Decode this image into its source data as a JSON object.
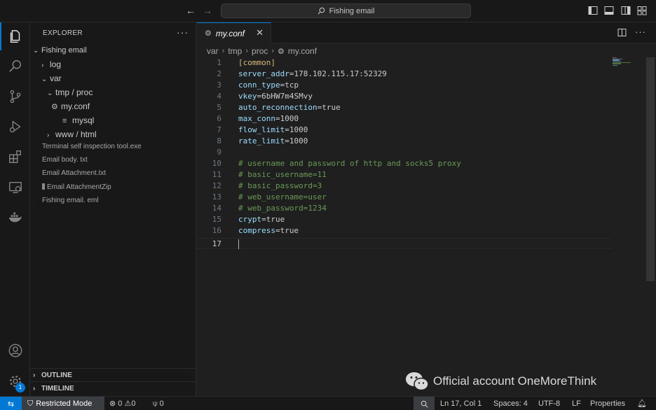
{
  "titlebar": {
    "search_text": "Fishing email"
  },
  "activity": {
    "settings_badge": "1"
  },
  "explorer": {
    "title": "EXPLORER",
    "more": "···",
    "root": "Fishing email",
    "items": {
      "log": "log",
      "var": "var",
      "tmp_proc": "tmp / proc",
      "my_conf": "my.conf",
      "mysql": "mysql",
      "www_html": "www / html",
      "terminal_tool": "Terminal self inspection tool.exe",
      "email_body": "Email body. txt",
      "email_attachment": "Email Attachment.txt",
      "email_attachment_zip": "Email AttachmentZip",
      "fishing_eml": "Fishing email. eml"
    },
    "outline": "OUTLINE",
    "timeline": "TIMELINE"
  },
  "editor": {
    "tab_label": "my.conf",
    "breadcrumb": [
      "var",
      "tmp",
      "proc",
      "my.conf"
    ],
    "lines": [
      {
        "n": "1",
        "text": "[common]"
      },
      {
        "n": "2",
        "key": "server_addr",
        "val": "=178.102.115.17:52329"
      },
      {
        "n": "3",
        "key": "conn_type",
        "val": "=tcp"
      },
      {
        "n": "4",
        "key": "vkey",
        "val": "=6bHW7m4SMvy"
      },
      {
        "n": "5",
        "key": "auto_reconnection",
        "val": "=true"
      },
      {
        "n": "6",
        "key": "max_conn",
        "val": "=1000"
      },
      {
        "n": "7",
        "key": "flow_limit",
        "val": "=1000"
      },
      {
        "n": "8",
        "key": "rate_limit",
        "val": "=1000"
      },
      {
        "n": "9",
        "text": ""
      },
      {
        "n": "10",
        "comment": "# username and password of http and socks5 proxy"
      },
      {
        "n": "11",
        "comment": "# basic_username=11"
      },
      {
        "n": "12",
        "comment": "# basic_password=3"
      },
      {
        "n": "13",
        "comment": "# web_username=user"
      },
      {
        "n": "14",
        "comment": "# web_password=1234"
      },
      {
        "n": "15",
        "key": "crypt",
        "val": "=true"
      },
      {
        "n": "16",
        "key": "compress",
        "val": "=true"
      },
      {
        "n": "17",
        "text": ""
      }
    ]
  },
  "watermark": "Official account OneMoreThink",
  "status": {
    "restricted": "Restricted Mode",
    "problems": "0",
    "warnings": "0",
    "ports": "0",
    "position": "Ln 17, Col 1",
    "spaces": "Spaces: 4",
    "encoding": "UTF-8",
    "eol": "LF",
    "language": "Properties"
  },
  "colors": {
    "accent": "#0078d4",
    "key": "#9cdcfe",
    "comment": "#6a9955",
    "bracket": "#d7ba7d"
  }
}
